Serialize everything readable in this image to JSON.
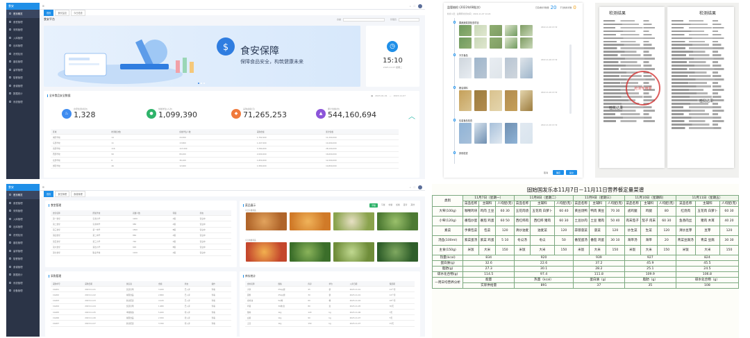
{
  "screen1": {
    "logo": "食安",
    "sidebar": [
      "首页概览",
      "食堂管理",
      "采购管理",
      "入库管理",
      "出库管理",
      "农残检测",
      "晨检管理",
      "留样管理",
      "陪餐管理",
      "食谱管理",
      "数据统计",
      "系统管理"
    ],
    "tabs": [
      "首页",
      "食安监控",
      "今日检查"
    ],
    "platform_title": "食安平台",
    "filter_label": "食堂",
    "user_label": "管理员",
    "banner_title": "食安保障",
    "banner_subtitle": "保障食品安全，构筑健康未来",
    "clock_time": "15:10",
    "clock_date": "2023-11-07 星期二",
    "stats_title": "全市食品安全数据",
    "date_from": "2023-01-01",
    "date_to": "2023-11-07",
    "stats": [
      {
        "label": "食安检测(批次)",
        "value": "1,328",
        "color": "#3f8cf0",
        "icon": "♨"
      },
      {
        "label": "供餐学生(人次)",
        "value": "1,099,390",
        "color": "#2fb36a",
        "icon": "●"
      },
      {
        "label": "采购金额(元)",
        "value": "71,265,253",
        "color": "#f07a3c",
        "icon": "◆"
      },
      {
        "label": "累计供餐(份)",
        "value": "544,160,694",
        "color": "#8c55d9",
        "icon": "▲"
      }
    ],
    "table_headers": [
      "区域",
      "检测批次数",
      "供餐学生人数",
      "采购金额",
      "累计供餐"
    ],
    "table_rows": [
      [
        "城区学校",
        "14",
        "24,500",
        "1,792,000",
        "11,200,000"
      ],
      [
        "东部学校",
        "11",
        "13,800",
        "1,247,000",
        "10,490,000"
      ],
      [
        "南部学校",
        "116",
        "117,000",
        "3,780,000",
        "28,100,000"
      ],
      [
        "西部学校",
        "99",
        "89,200",
        "2,090,000",
        "16,600,000"
      ],
      [
        "北部学校",
        "6",
        "36,100",
        "1,650,000",
        "12,200,000"
      ],
      [
        "郊区学校",
        "46",
        "12,900",
        "1,580,000",
        "14,800,000"
      ]
    ]
  },
  "screen2": {
    "title": "监管抽检 (2022年08批次)",
    "count_left_label": "已完成检查数量",
    "count_left": "20",
    "count_right_label": "不合格检查数",
    "count_right": "0",
    "meta": "检查人员：赵明明    检查时间：2022-11-07 14:24",
    "groups": [
      "果蔬蔬菜类检查项目",
      "冷冻食品",
      "粮油调料",
      "包装食品检查",
      "其他检查"
    ],
    "group_time": "2022-11-04 13:32",
    "btn_cancel": "取消",
    "btn_confirm": "确定",
    "btn_submit": "提交"
  },
  "screen3": {
    "report_title_1": "检测结果",
    "report_title_2": "检测结果",
    "report_title_3": "检测结果",
    "report_title_4": "检测结果",
    "stamp_text": "检测专用章"
  },
  "screen4": {
    "logo": "食安",
    "sidebar": [
      "首页概览",
      "食堂管理",
      "采购管理",
      "入库管理",
      "出库管理",
      "农残检测",
      "晨检管理",
      "留样管理",
      "陪餐管理",
      "食谱管理",
      "数据统计",
      "系统管理",
      "设备管理"
    ],
    "tabs": [
      "首页",
      "食堂管理",
      "食谱管理"
    ],
    "panel1_title": "食堂管理",
    "panel1_headers": [
      "食堂名称",
      "所属学校",
      "就餐人数",
      "等级",
      "状态"
    ],
    "panel1_rows": [
      [
        "第一食堂",
        "实验小学",
        "1200",
        "A级",
        "营业中"
      ],
      [
        "第二食堂",
        "实验中学",
        "980",
        "A级",
        "营业中"
      ],
      [
        "第三食堂",
        "第一中学",
        "1500",
        "B级",
        "营业中"
      ],
      [
        "第四食堂",
        "第二中学",
        "860",
        "A级",
        "营业中"
      ],
      [
        "第五食堂",
        "第三小学",
        "740",
        "A级",
        "营业中"
      ],
      [
        "第六食堂",
        "第四小学",
        "620",
        "B级",
        "营业中"
      ],
      [
        "第七食堂",
        "职业学校",
        "1100",
        "A级",
        "营业中"
      ]
    ],
    "panel2_title": "菜品展示",
    "panel2_tabs": [
      "早餐",
      "午餐",
      "晚餐",
      "加餐",
      "夜宵",
      "其他"
    ],
    "panel2_sub1": "今日午餐菜品",
    "panel2_sub2": "今日晚餐菜品",
    "panel3_title": "采购管理",
    "panel3_headers": [
      "采购单号",
      "采购日期",
      "供应商",
      "金额",
      "状态",
      "操作"
    ],
    "panel3_rows": [
      [
        "CG001",
        "2023-11-01",
        "优选农场",
        "3,200",
        "已入库",
        "查看"
      ],
      [
        "CG002",
        "2023-11-02",
        "绿源食品",
        "2,860",
        "已入库",
        "查看"
      ],
      [
        "CG003",
        "2023-11-03",
        "鲜达配送",
        "4,120",
        "已入库",
        "查看"
      ],
      [
        "CG004",
        "2023-11-04",
        "优选农场",
        "1,980",
        "已入库",
        "查看"
      ],
      [
        "CG005",
        "2023-11-05",
        "丰收粮油",
        "5,400",
        "待入库",
        "查看"
      ],
      [
        "CG006",
        "2023-11-06",
        "绿源食品",
        "2,300",
        "待入库",
        "查看"
      ],
      [
        "CG007",
        "2023-11-07",
        "鲜达配送",
        "3,760",
        "待入库",
        "查看"
      ]
    ],
    "panel4_title": "库存统计",
    "panel4_headers": [
      "食材名称",
      "规格",
      "库存",
      "单位",
      "入库日期",
      "保质期"
    ],
    "panel4_rows": [
      [
        "大米",
        "25kg/袋",
        "45",
        "袋",
        "2023-11-01",
        "12个月"
      ],
      [
        "面粉",
        "25kg/袋",
        "30",
        "袋",
        "2023-11-01",
        "12个月"
      ],
      [
        "食用油",
        "5L/桶",
        "60",
        "桶",
        "2023-11-02",
        "18个月"
      ],
      [
        "鸡蛋",
        "30枚/盒",
        "80",
        "盒",
        "2023-11-05",
        "30天"
      ],
      [
        "猪肉",
        "1kg",
        "120",
        "kg",
        "2023-11-06",
        "3天"
      ],
      [
        "白菜",
        "1kg",
        "90",
        "kg",
        "2023-11-07",
        "5天"
      ],
      [
        "土豆",
        "1kg",
        "150",
        "kg",
        "2023-11-07",
        "15天"
      ]
    ]
  },
  "screen5": {
    "title": "固始国发乐本11月7日－11月11日营养餐定量菜谱",
    "col_category": "类别",
    "col_dish": "菜品名称",
    "col_main": "主辅料",
    "col_per": "人均配(克)",
    "days": [
      "11月7日（星期一）",
      "11月8日（星期二）",
      "11月9日（星期三）",
      "11月10日（星期四）",
      "11月11日（星期五）"
    ],
    "lunch_label": "午餐",
    "rows_left": [
      "大荤(100g)",
      "小荤(120g)",
      "素菜",
      "汤品(100ml)",
      "主食(150g)"
    ],
    "analysis_label": "当日营养分析",
    "analysis_rows": [
      "热量(kcal)",
      "蛋白质(g)",
      "脂肪(g)",
      "碳水化合物(g)"
    ],
    "analysis_values": [
      [
        "834",
        "920",
        "939",
        "927",
        "824"
      ],
      [
        "32.6",
        "22.6",
        "37.2",
        "45.9",
        "45.5"
      ],
      [
        "27.3",
        "30.1",
        "28.2",
        "25.1",
        "24.5"
      ],
      [
        "114.5",
        "97.4",
        "111.8",
        "109.9",
        "106.8"
      ]
    ],
    "week_label": "一周日均营养分析",
    "week_headers": [
      "能量",
      "热量（kcal）",
      "蛋白质（g）",
      "脂肪（g）",
      "碳水化合物（g）"
    ],
    "week_sub": "实际供给量",
    "week_values": [
      "891",
      "37",
      "35",
      "108"
    ],
    "dishes": [
      [
        "咖喱鸡块",
        "鸡肉 土豆",
        "60 30",
        "五花肉烧",
        "五花肉 白萝卜",
        "60 40",
        "黄豆烧鸭",
        "鸭肉 黄豆",
        "70 30",
        "卤鸡腿",
        "鸡腿",
        "80",
        "红烧肉",
        "五花肉 白萝卜",
        "60 30"
      ],
      [
        "番茄炒蛋",
        "番茄 鸡蛋",
        "60 50",
        "西红柿肉",
        "西红柿 猪肉",
        "60 30",
        "土豆炒肉",
        "土豆 猪肉",
        "50 40",
        "肉末茄子",
        "茄子 肉末",
        "60 30",
        "鱼香肉丝",
        "猪肉 木耳",
        "40 20"
      ],
      [
        "手撕包菜",
        "包菜",
        "120",
        "清炒油麦",
        "油麦菜",
        "120",
        "蒜蓉菠菜",
        "菠菜",
        "120",
        "炒生菜",
        "生菜",
        "120",
        "清炒豆芽",
        "豆芽",
        "120"
      ],
      [
        "紫菜蛋汤",
        "紫菜 鸡蛋",
        "5 10",
        "冬瓜汤",
        "冬瓜",
        "50",
        "番茄蛋汤",
        "番茄 鸡蛋",
        "30 10",
        "海带汤",
        "海带",
        "20",
        "青菜豆腐汤",
        "青菜 豆腐",
        "30 30"
      ],
      [
        "米饭",
        "大米",
        "150",
        "米饭",
        "大米",
        "150",
        "米饭",
        "大米",
        "150",
        "米饭",
        "大米",
        "150",
        "米饭",
        "大米",
        "150"
      ]
    ]
  }
}
